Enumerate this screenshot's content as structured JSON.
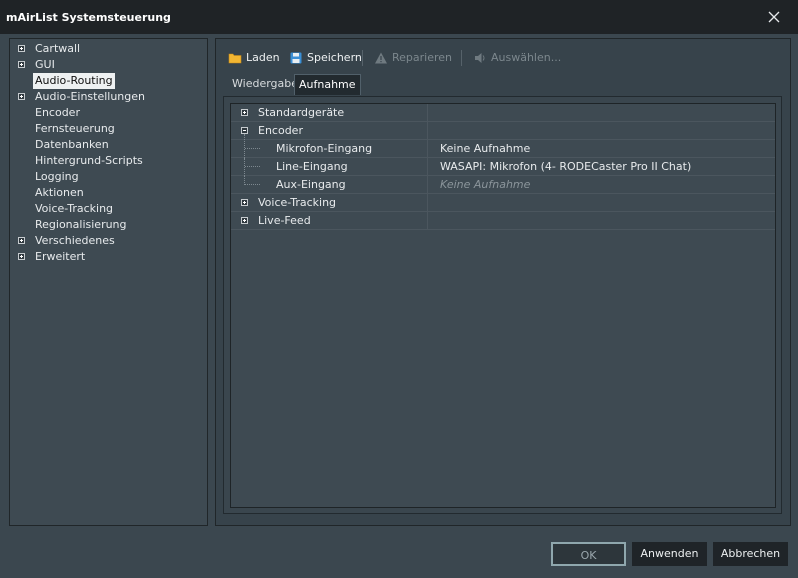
{
  "window": {
    "title": "mAirList Systemsteuerung"
  },
  "tree": [
    {
      "label": "Cartwall",
      "expandable": true,
      "selected": false
    },
    {
      "label": "GUI",
      "expandable": true,
      "selected": false
    },
    {
      "label": "Audio-Routing",
      "expandable": false,
      "selected": true
    },
    {
      "label": "Audio-Einstellungen",
      "expandable": true,
      "selected": false
    },
    {
      "label": "Encoder",
      "expandable": false,
      "selected": false
    },
    {
      "label": "Fernsteuerung",
      "expandable": false,
      "selected": false
    },
    {
      "label": "Datenbanken",
      "expandable": false,
      "selected": false
    },
    {
      "label": "Hintergrund-Scripts",
      "expandable": false,
      "selected": false
    },
    {
      "label": "Logging",
      "expandable": false,
      "selected": false
    },
    {
      "label": "Aktionen",
      "expandable": false,
      "selected": false
    },
    {
      "label": "Voice-Tracking",
      "expandable": false,
      "selected": false
    },
    {
      "label": "Regionalisierung",
      "expandable": false,
      "selected": false
    },
    {
      "label": "Verschiedenes",
      "expandable": true,
      "selected": false
    },
    {
      "label": "Erweitert",
      "expandable": true,
      "selected": false
    }
  ],
  "toolbar": {
    "load": "Laden",
    "save": "Speichern",
    "repair": "Reparieren",
    "select": "Auswählen..."
  },
  "tabs": {
    "playback": "Wiedergabe",
    "record": "Aufnahme"
  },
  "grid": {
    "rows": [
      {
        "name": "Standardgeräte",
        "value": "",
        "level": 0,
        "expander": "plus"
      },
      {
        "name": "Encoder",
        "value": "",
        "level": 0,
        "expander": "minus"
      },
      {
        "name": "Mikrofon-Eingang",
        "value": "Keine Aufnahme",
        "level": 1,
        "expander": "none"
      },
      {
        "name": "Line-Eingang",
        "value": "WASAPI: Mikrofon (4- RODECaster Pro II Chat)",
        "level": 1,
        "expander": "none"
      },
      {
        "name": "Aux-Eingang",
        "value": "Keine Aufnahme",
        "level": 1,
        "expander": "none",
        "placeholder": true
      },
      {
        "name": "Voice-Tracking",
        "value": "",
        "level": 0,
        "expander": "plus"
      },
      {
        "name": "Live-Feed",
        "value": "",
        "level": 0,
        "expander": "plus"
      }
    ]
  },
  "buttons": {
    "ok": "OK",
    "apply": "Anwenden",
    "cancel": "Abbrechen"
  },
  "icons": {
    "close": "close-icon",
    "load": "folder-icon",
    "save": "floppy-disk-icon",
    "repair": "warning-icon",
    "select": "speaker-icon"
  },
  "colors": {
    "accent": "#8fa7ad",
    "folder": "#f2b632",
    "floppy": "#3a8fd6"
  }
}
